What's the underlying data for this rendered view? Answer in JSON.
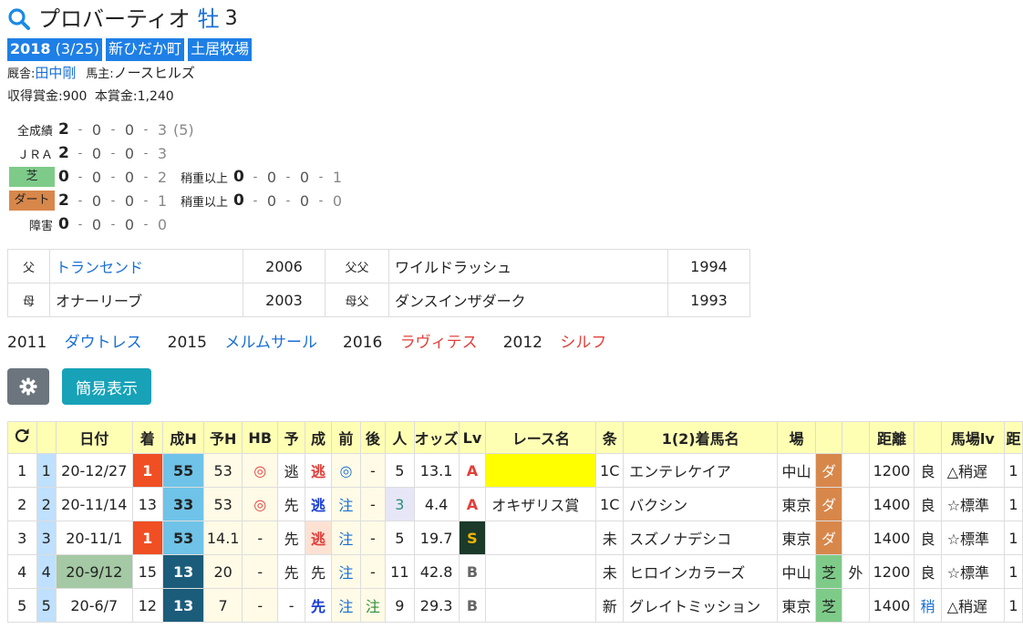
{
  "horse": {
    "name": "プロバーティオ",
    "sex": "牡",
    "age": "3",
    "birth_year": "2018",
    "birth_date": "(3/25)",
    "region": "新ひだか町",
    "breeder": "土居牧場",
    "trainer_label": "厩舎:",
    "trainer": "田中剛",
    "owner_label": "馬主:",
    "owner": "ノースヒルズ",
    "earnings_label": "収得賞金:",
    "earnings": "900",
    "prize_label": "本賞金:",
    "prize": "1,240"
  },
  "records": [
    {
      "label": "全成績",
      "a": "2",
      "b": "0",
      "c": "0",
      "d": "3",
      "extra": "(5)"
    },
    {
      "label": "ＪＲＡ",
      "a": "2",
      "b": "0",
      "c": "0",
      "d": "3"
    },
    {
      "label": "芝",
      "a": "0",
      "b": "0",
      "c": "0",
      "d": "2",
      "sub_label": "稍重以上",
      "sa": "0",
      "sb": "0",
      "sc": "0",
      "sd": "1"
    },
    {
      "label": "ダート",
      "a": "2",
      "b": "0",
      "c": "0",
      "d": "1",
      "sub_label": "稍重以上",
      "sa": "0",
      "sb": "0",
      "sc": "0",
      "sd": "0"
    },
    {
      "label": "障害",
      "a": "0",
      "b": "0",
      "c": "0",
      "d": "0"
    }
  ],
  "pedigree": [
    {
      "key": "父",
      "name": "トランセンド",
      "year": "2006",
      "key2": "父父",
      "name2": "ワイルドラッシュ",
      "year2": "1994"
    },
    {
      "key": "母",
      "name": "オナーリーブ",
      "year": "2003",
      "key2": "母父",
      "name2": "ダンスインザダーク",
      "year2": "1993"
    }
  ],
  "siblings": [
    {
      "year": "2011",
      "name": "ダウトレス"
    },
    {
      "year": "2015",
      "name": "メルムサール"
    },
    {
      "year": "2016",
      "name": "ラヴィテス"
    },
    {
      "year": "2012",
      "name": "シルフ"
    }
  ],
  "buttons": {
    "simple_view": "簡易表示"
  },
  "results": {
    "headers": [
      "",
      "",
      "日付",
      "着",
      "成H",
      "予H",
      "HB",
      "予",
      "成",
      "前",
      "後",
      "人",
      "オッズ",
      "Lv",
      "レース名",
      "条",
      "1(2)着馬名",
      "場",
      "",
      "",
      "距離",
      "",
      "馬場lv",
      "距"
    ],
    "rows": [
      {
        "n": "1",
        "m": "1",
        "date": "20-12/27",
        "rank": "1",
        "seiH": "55",
        "yoH": "53",
        "hb": "◎",
        "yo": "逃",
        "sei": "逃",
        "mae": "◎",
        "ato": "-",
        "pop": "5",
        "odds": "13.1",
        "lv": "A",
        "race": "",
        "cls": "1C",
        "horse": "エンテレケイア",
        "place": "中山",
        "surface": "ダ",
        "rail": "",
        "dist": "1200",
        "cond": "良",
        "track": "△稍遅",
        "extra": "1"
      },
      {
        "n": "2",
        "m": "2",
        "date": "20-11/14",
        "rank": "13",
        "seiH": "33",
        "yoH": "53",
        "hb": "◎",
        "yo": "先",
        "sei": "逃",
        "mae": "注",
        "ato": "-",
        "pop": "3",
        "odds": "4.4",
        "lv": "A",
        "race": "オキザリス賞",
        "cls": "1C",
        "horse": "バクシン",
        "place": "東京",
        "surface": "ダ",
        "rail": "",
        "dist": "1400",
        "cond": "良",
        "track": "☆標準",
        "extra": "1"
      },
      {
        "n": "3",
        "m": "3",
        "date": "20-11/1",
        "rank": "1",
        "seiH": "53",
        "yoH": "14.1",
        "hb": "-",
        "yo": "先",
        "sei": "逃",
        "mae": "注",
        "ato": "-",
        "pop": "5",
        "odds": "19.7",
        "lv": "S",
        "race": "",
        "cls": "未",
        "horse": "スズノナデシコ",
        "place": "東京",
        "surface": "ダ",
        "rail": "",
        "dist": "1400",
        "cond": "良",
        "track": "☆標準",
        "extra": "1"
      },
      {
        "n": "4",
        "m": "4",
        "date": "20-9/12",
        "rank": "15",
        "seiH": "13",
        "yoH": "20",
        "hb": "-",
        "yo": "先",
        "sei": "先",
        "mae": "注",
        "ato": "-",
        "pop": "11",
        "odds": "42.8",
        "lv": "B",
        "race": "",
        "cls": "未",
        "horse": "ヒロインカラーズ",
        "place": "中山",
        "surface": "芝",
        "rail": "外",
        "dist": "1200",
        "cond": "良",
        "track": "☆標準",
        "extra": "1"
      },
      {
        "n": "5",
        "m": "5",
        "date": "20-6/7",
        "rank": "12",
        "seiH": "13",
        "yoH": "7",
        "hb": "-",
        "yo": "-",
        "sei": "先",
        "mae": "注",
        "ato": "注",
        "pop": "9",
        "odds": "29.3",
        "lv": "B",
        "race": "",
        "cls": "新",
        "horse": "グレイトミッション",
        "place": "東京",
        "surface": "芝",
        "rail": "",
        "dist": "1400",
        "cond": "稍",
        "track": "△稍遅",
        "extra": "1"
      }
    ]
  },
  "colors": {
    "accent": "#1e7fe6",
    "teal_button": "#17a2b8",
    "gray_button": "#6c757d",
    "header_bg": "#ffffb4",
    "win": "#f04e23",
    "turf": "#7ecb89",
    "dirt": "#d8874b"
  },
  "icons": {
    "title": "search-icon",
    "settings": "gear-icon",
    "reload": "refresh-icon"
  }
}
